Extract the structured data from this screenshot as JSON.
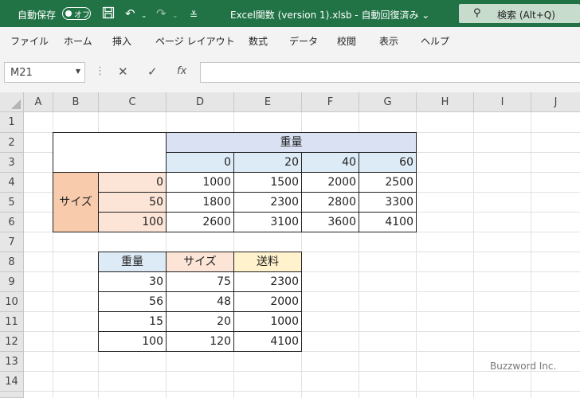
{
  "titlebar": {
    "autosave_label": "自動保存",
    "autosave_toggle": "オフ",
    "document_title": "Excel関数 (version 1).xlsb  -  自動回復済み  ⌄",
    "search_placeholder": "検索 (Alt+Q)"
  },
  "ribbon": {
    "tabs": [
      "ファイル",
      "ホーム",
      "挿入",
      "ページ レイアウト",
      "数式",
      "データ",
      "校閲",
      "表示",
      "ヘルプ"
    ]
  },
  "formula_bar": {
    "name_box": "M21",
    "formula": ""
  },
  "columns": [
    "A",
    "B",
    "C",
    "D",
    "E",
    "F",
    "G",
    "H",
    "I",
    "J"
  ],
  "rows": [
    "1",
    "2",
    "3",
    "4",
    "5",
    "6",
    "7",
    "8",
    "9",
    "10",
    "11",
    "12",
    "13",
    "14"
  ],
  "table1": {
    "header_weight": "重量",
    "weights": [
      "0",
      "20",
      "40",
      "60"
    ],
    "size_label": "サイズ",
    "sizes": [
      "0",
      "50",
      "100"
    ],
    "values": [
      [
        "1000",
        "1500",
        "2000",
        "2500"
      ],
      [
        "1800",
        "2300",
        "2800",
        "3300"
      ],
      [
        "2600",
        "3100",
        "3600",
        "4100"
      ]
    ]
  },
  "table2": {
    "headers": [
      "重量",
      "サイズ",
      "送料"
    ],
    "rows": [
      [
        "30",
        "75",
        "2300"
      ],
      [
        "56",
        "48",
        "2000"
      ],
      [
        "15",
        "20",
        "1000"
      ],
      [
        "100",
        "120",
        "4100"
      ]
    ]
  },
  "watermark": "Buzzword Inc.",
  "colors": {
    "title_bar": "#217346",
    "weight_header_fill": "#d9e1f2",
    "weight_value_fill": "#ddebf7",
    "size_label_fill": "#f8cbad",
    "size_value_fill": "#fce4d6",
    "postage_header_fill": "#fff2cc"
  }
}
